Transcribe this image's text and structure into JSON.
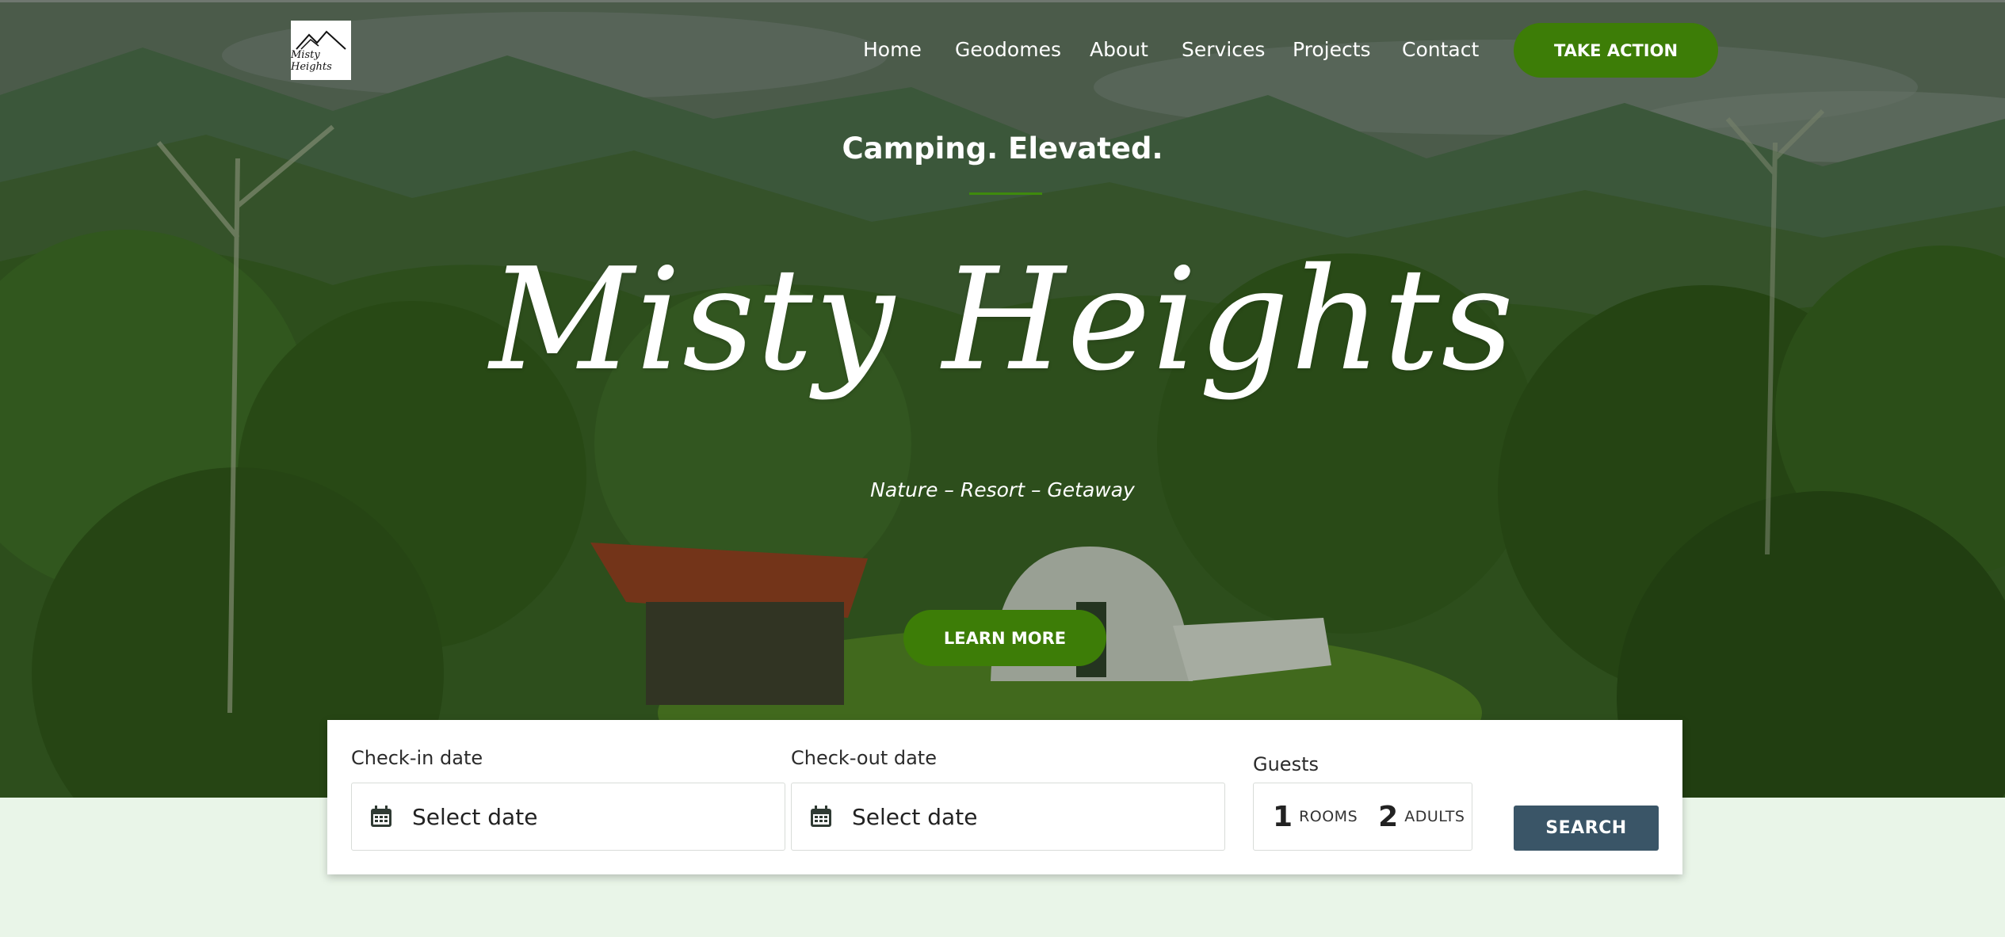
{
  "brand": {
    "logo_text": "Misty Heights"
  },
  "nav": {
    "items": [
      {
        "label": "Home"
      },
      {
        "label": "Geodomes"
      },
      {
        "label": "About"
      },
      {
        "label": "Services"
      },
      {
        "label": "Projects"
      },
      {
        "label": "Contact"
      }
    ],
    "cta_label": "TAKE ACTION"
  },
  "hero": {
    "tagline": "Camping. Elevated.",
    "title": "Misty Heights",
    "subtitle": "Nature – Resort – Getaway",
    "button_label": "LEARN MORE"
  },
  "booking": {
    "checkin": {
      "label": "Check-in date",
      "placeholder": "Select date"
    },
    "checkout": {
      "label": "Check-out date",
      "placeholder": "Select date"
    },
    "guests": {
      "label": "Guests",
      "rooms_value": "1",
      "rooms_label": "ROOMS",
      "adults_value": "2",
      "adults_label": "ADULTS"
    },
    "search_label": "SEARCH"
  },
  "colors": {
    "accent_green": "#3d7d07",
    "search_button": "#3a5567",
    "page_background": "#e9f5e8"
  },
  "icons": [
    "calendar-icon",
    "logo-mountain-icon"
  ]
}
